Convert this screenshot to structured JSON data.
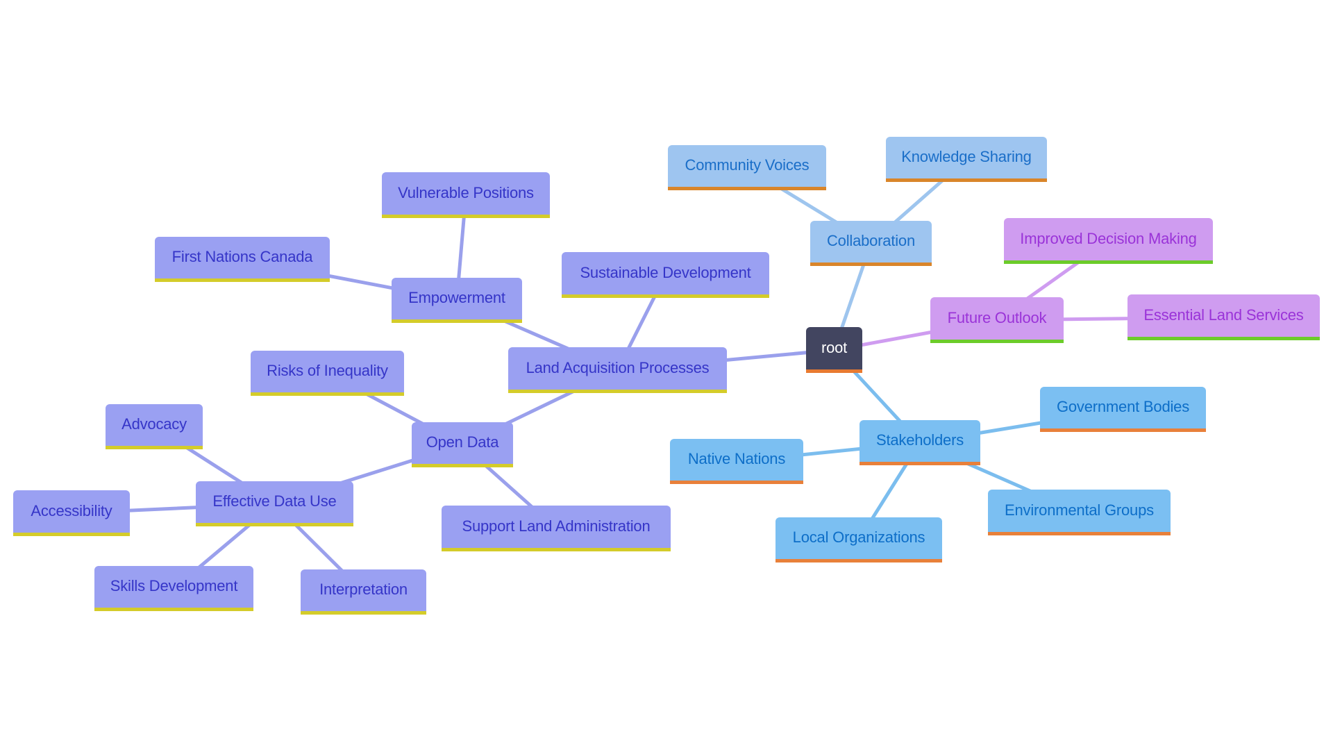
{
  "diagram": {
    "type": "mindmap",
    "root": "root",
    "branches": {
      "land": {
        "fill": "#9aa0f2",
        "text": "#3535c8",
        "bar": "#d4cc2a",
        "edge": "#9aa0ec"
      },
      "collab": {
        "fill": "#9ec5f0",
        "text": "#1a6ec8",
        "bar": "#d9852a",
        "edge": "#9ec5ee"
      },
      "stake": {
        "fill": "#7bbff2",
        "text": "#0d6ec8",
        "bar": "#e8803a",
        "edge": "#7bbdee"
      },
      "future": {
        "fill": "#cf9cf0",
        "text": "#9a33d8",
        "bar": "#6ccc2a",
        "edge": "#cf9cf0"
      },
      "root": {
        "fill": "#424560",
        "text": "#ffffff",
        "bar": "#e87a30",
        "edge": "#424560"
      }
    },
    "nodes": [
      {
        "id": "root",
        "label": "root",
        "branch": "root"
      },
      {
        "id": "land",
        "label": "Land Acquisition Processes",
        "branch": "land",
        "parent": "root"
      },
      {
        "id": "sustainable",
        "label": "Sustainable Development",
        "branch": "land",
        "parent": "land"
      },
      {
        "id": "empowerment",
        "label": "Empowerment",
        "branch": "land",
        "parent": "land"
      },
      {
        "id": "vulnerable",
        "label": "Vulnerable Positions",
        "branch": "land",
        "parent": "empowerment"
      },
      {
        "id": "firstnations",
        "label": "First Nations Canada",
        "branch": "land",
        "parent": "empowerment"
      },
      {
        "id": "opendata",
        "label": "Open Data",
        "branch": "land",
        "parent": "land"
      },
      {
        "id": "risks",
        "label": "Risks of Inequality",
        "branch": "land",
        "parent": "opendata"
      },
      {
        "id": "support",
        "label": "Support Land Administration",
        "branch": "land",
        "parent": "opendata"
      },
      {
        "id": "effective",
        "label": "Effective Data Use",
        "branch": "land",
        "parent": "opendata"
      },
      {
        "id": "advocacy",
        "label": "Advocacy",
        "branch": "land",
        "parent": "effective"
      },
      {
        "id": "accessibility",
        "label": "Accessibility",
        "branch": "land",
        "parent": "effective"
      },
      {
        "id": "skills",
        "label": "Skills Development",
        "branch": "land",
        "parent": "effective"
      },
      {
        "id": "interpretation",
        "label": "Interpretation",
        "branch": "land",
        "parent": "effective"
      },
      {
        "id": "collaboration",
        "label": "Collaboration",
        "branch": "collab",
        "parent": "root"
      },
      {
        "id": "community",
        "label": "Community Voices",
        "branch": "collab",
        "parent": "collaboration"
      },
      {
        "id": "knowledge",
        "label": "Knowledge Sharing",
        "branch": "collab",
        "parent": "collaboration"
      },
      {
        "id": "future",
        "label": "Future Outlook",
        "branch": "future",
        "parent": "root"
      },
      {
        "id": "improved",
        "label": "Improved Decision Making",
        "branch": "future",
        "parent": "future"
      },
      {
        "id": "essential",
        "label": "Essential Land Services",
        "branch": "future",
        "parent": "future"
      },
      {
        "id": "stakeholders",
        "label": "Stakeholders",
        "branch": "stake",
        "parent": "root"
      },
      {
        "id": "government",
        "label": "Government Bodies",
        "branch": "stake",
        "parent": "stakeholders"
      },
      {
        "id": "native",
        "label": "Native Nations",
        "branch": "stake",
        "parent": "stakeholders"
      },
      {
        "id": "environmental",
        "label": "Environmental Groups",
        "branch": "stake",
        "parent": "stakeholders"
      },
      {
        "id": "local",
        "label": "Local Organizations",
        "branch": "stake",
        "parent": "stakeholders"
      }
    ]
  }
}
